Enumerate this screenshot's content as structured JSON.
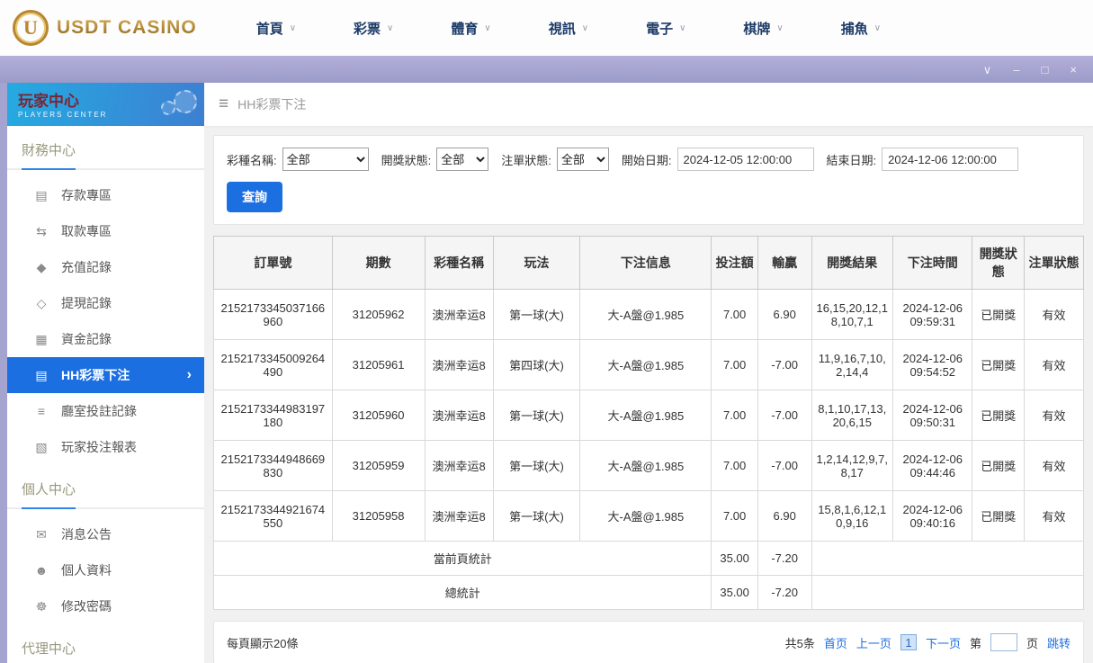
{
  "colors": {
    "accent-blue": "#1c6fe0",
    "lavender": "#a5a3cf",
    "header-blue-1": "#25aae1",
    "header-blue-2": "#3d7fd2",
    "logo-gold": "#b8862f",
    "nav-text": "#1c3a66",
    "title-maroon": "#7b2433"
  },
  "icons": {
    "chevron-down": "∨",
    "minimize": "–",
    "maximize": "□",
    "close": "×",
    "hamburger": "≡",
    "arrow-right": "›"
  },
  "top_nav": {
    "logo": {
      "badge_letter": "U",
      "text": "USDT CASINO"
    },
    "items": [
      {
        "key": "home",
        "label": "首頁"
      },
      {
        "key": "lottery",
        "label": "彩票"
      },
      {
        "key": "sports",
        "label": "體育"
      },
      {
        "key": "video",
        "label": "視訊"
      },
      {
        "key": "electronic",
        "label": "電子"
      },
      {
        "key": "chess",
        "label": "棋牌"
      },
      {
        "key": "fishing",
        "label": "捕魚"
      }
    ]
  },
  "window_bar": {
    "controls": [
      {
        "key": "chevron-down",
        "glyph": "∨"
      },
      {
        "key": "minimize",
        "glyph": "–"
      },
      {
        "key": "maximize",
        "glyph": "□"
      },
      {
        "key": "close",
        "glyph": "×"
      }
    ]
  },
  "sidebar": {
    "title": "玩家中心",
    "subtitle": "PLAYERS CENTER",
    "sections": [
      {
        "key": "finance",
        "label": "財務中心",
        "items": [
          {
            "key": "deposit",
            "label": "存款專區",
            "icon": "▤",
            "icon_name": "deposit-icon",
            "active": false
          },
          {
            "key": "withdraw",
            "label": "取款專區",
            "icon": "⇆",
            "icon_name": "withdraw-icon",
            "active": false
          },
          {
            "key": "recharge-record",
            "label": "充值記錄",
            "icon": "◆",
            "icon_name": "recharge-record-icon",
            "active": false
          },
          {
            "key": "withdrawal-record",
            "label": "提現記錄",
            "icon": "◇",
            "icon_name": "withdrawal-record-icon",
            "active": false
          },
          {
            "key": "funds-record",
            "label": "資金記錄",
            "icon": "▦",
            "icon_name": "funds-record-icon",
            "active": false
          },
          {
            "key": "hh-lottery-bet",
            "label": "HH彩票下注",
            "icon": "▤",
            "icon_name": "hh-lottery-bet-icon",
            "active": true
          },
          {
            "key": "hall-bet-record",
            "label": "廳室投註記錄",
            "icon": "≡",
            "icon_name": "hall-bet-record-icon",
            "active": false
          },
          {
            "key": "player-bet-report",
            "label": "玩家投注報表",
            "icon": "▧",
            "icon_name": "player-bet-report-icon",
            "active": false
          }
        ]
      },
      {
        "key": "personal",
        "label": "個人中心",
        "items": [
          {
            "key": "messages",
            "label": "消息公告",
            "icon": "✉",
            "icon_name": "bell-icon",
            "active": false
          },
          {
            "key": "profile",
            "label": "個人資料",
            "icon": "☻",
            "icon_name": "person-icon",
            "active": false
          },
          {
            "key": "change-password",
            "label": "修改密碼",
            "icon": "☸",
            "icon_name": "gear-icon",
            "active": false
          }
        ]
      },
      {
        "key": "agent",
        "label": "代理中心",
        "items": []
      }
    ]
  },
  "breadcrumb": {
    "title": "HH彩票下注"
  },
  "filters": {
    "lottery_name_label": "彩種名稱:",
    "lottery_name_value": "全部",
    "draw_status_label": "開獎狀態:",
    "draw_status_value": "全部",
    "order_status_label": "注單狀態:",
    "order_status_value": "全部",
    "start_date_label": "開始日期:",
    "start_date_value": "2024-12-05 12:00:00",
    "end_date_label": "結束日期:",
    "end_date_value": "2024-12-06 12:00:00",
    "search_button": "查詢"
  },
  "table": {
    "headers": [
      {
        "key": "order-no",
        "label": "訂單號"
      },
      {
        "key": "issue",
        "label": "期數"
      },
      {
        "key": "lottery-name",
        "label": "彩種名稱"
      },
      {
        "key": "play",
        "label": "玩法"
      },
      {
        "key": "bet-info",
        "label": "下注信息"
      },
      {
        "key": "bet-amount",
        "label": "投注額"
      },
      {
        "key": "win-loss",
        "label": "輸贏"
      },
      {
        "key": "draw-result",
        "label": "開獎結果"
      },
      {
        "key": "bet-time",
        "label": "下注時間"
      },
      {
        "key": "draw-status",
        "label": "開獎狀態"
      },
      {
        "key": "order-status",
        "label": "注單狀態"
      }
    ],
    "rows": [
      [
        "2152173345037166960",
        "31205962",
        "澳洲幸运8",
        "第一球(大)",
        "大-A盤@1.985",
        "7.00",
        "6.90",
        "16,15,20,12,18,10,7,1",
        "2024-12-06 09:59:31",
        "已開獎",
        "有效"
      ],
      [
        "2152173345009264490",
        "31205961",
        "澳洲幸运8",
        "第四球(大)",
        "大-A盤@1.985",
        "7.00",
        "-7.00",
        "11,9,16,7,10,2,14,4",
        "2024-12-06 09:54:52",
        "已開獎",
        "有效"
      ],
      [
        "2152173344983197180",
        "31205960",
        "澳洲幸运8",
        "第一球(大)",
        "大-A盤@1.985",
        "7.00",
        "-7.00",
        "8,1,10,17,13,20,6,15",
        "2024-12-06 09:50:31",
        "已開獎",
        "有效"
      ],
      [
        "2152173344948669830",
        "31205959",
        "澳洲幸运8",
        "第一球(大)",
        "大-A盤@1.985",
        "7.00",
        "-7.00",
        "1,2,14,12,9,7,8,17",
        "2024-12-06 09:44:46",
        "已開獎",
        "有效"
      ],
      [
        "2152173344921674550",
        "31205958",
        "澳洲幸运8",
        "第一球(大)",
        "大-A盤@1.985",
        "7.00",
        "6.90",
        "15,8,1,6,12,10,9,16",
        "2024-12-06 09:40:16",
        "已開獎",
        "有效"
      ]
    ],
    "summary_rows": [
      {
        "key": "current-page",
        "label": "當前頁統計",
        "bet_total": "35.00",
        "win_loss": "-7.20"
      },
      {
        "key": "total",
        "label": "總統計",
        "bet_total": "35.00",
        "win_loss": "-7.20"
      }
    ]
  },
  "footer": {
    "page_size_text": "每頁顯示20條",
    "total_text": "共5条",
    "first_page": "首页",
    "prev_page": "上一页",
    "current_page": "1",
    "next_page": "下一页",
    "jump_prefix": "第",
    "jump_suffix": "页",
    "jump_button": "跳转"
  }
}
